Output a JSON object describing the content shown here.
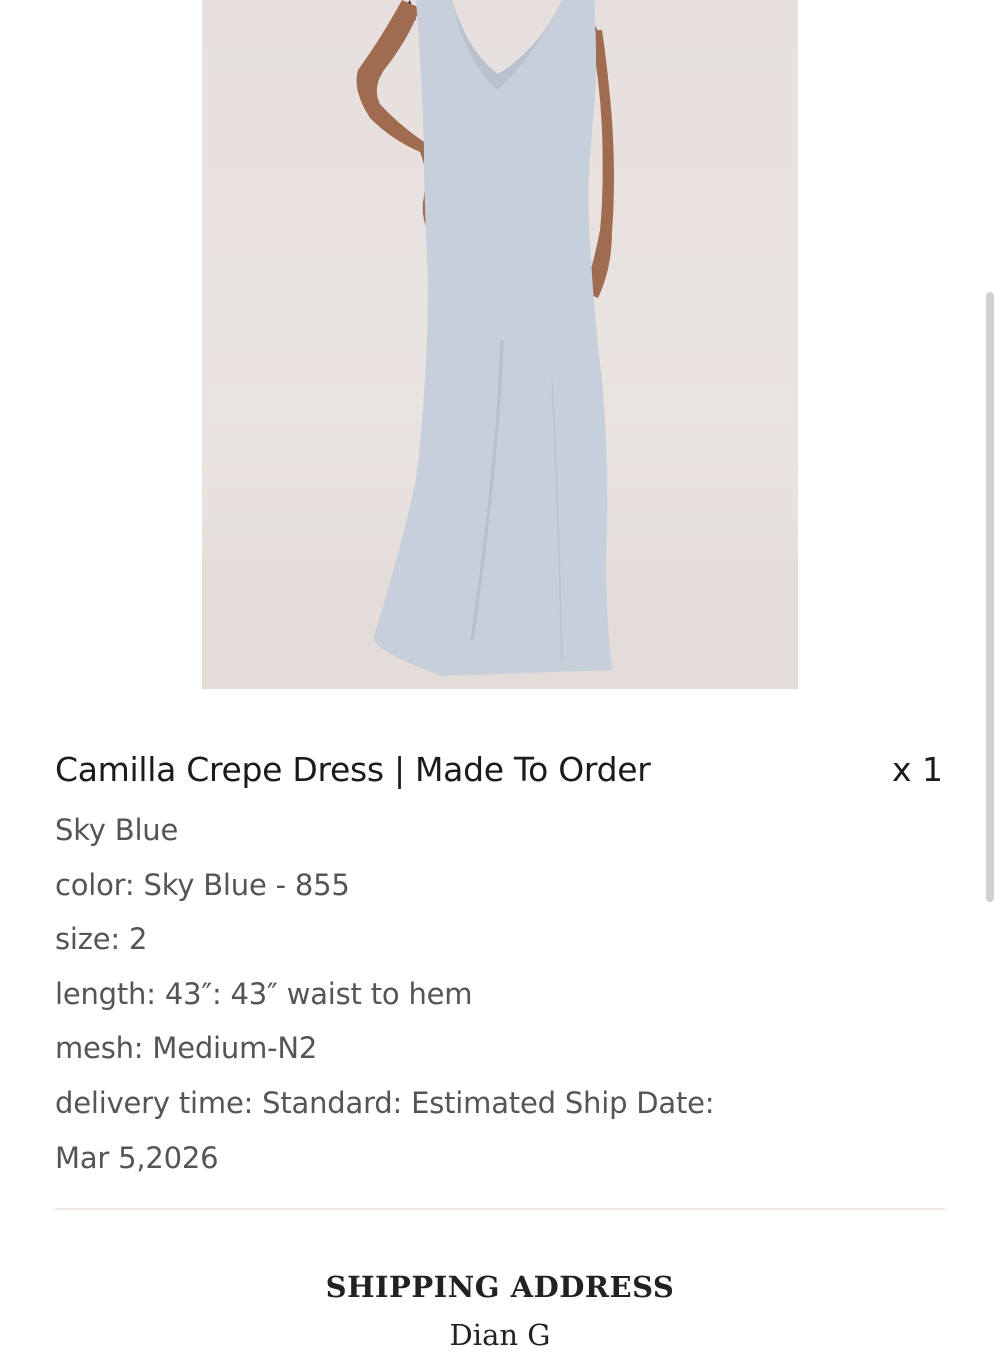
{
  "product_image": {
    "alt": "Camilla Crepe Dress in Sky Blue worn by model"
  },
  "order_item": {
    "title": "Camilla Crepe Dress | Made To Order",
    "quantity": "x 1",
    "variants": [
      "Sky Blue",
      "color: Sky Blue - 855",
      "size: 2",
      "length: 43″: 43″ waist to hem",
      "mesh: Medium-N2",
      "delivery time: Standard: Estimated Ship Date: Mar 5,2026"
    ]
  },
  "shipping": {
    "heading": "SHIPPING ADDRESS",
    "name": "Dian G"
  },
  "colors": {
    "image_background": "#e6dfdd",
    "dress": "#c5cdd8",
    "divider": "#f1e7e5",
    "variant_text": "#555555"
  }
}
